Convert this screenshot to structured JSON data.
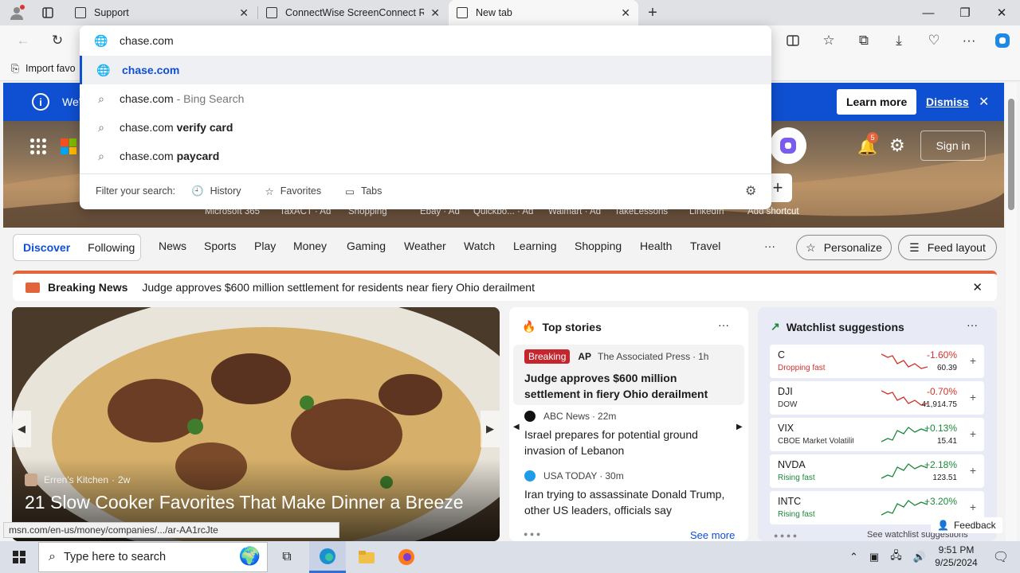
{
  "tabs": [
    {
      "title": "Support"
    },
    {
      "title": "ConnectWise ScreenConnect Re"
    },
    {
      "title": "New tab"
    }
  ],
  "omnibox": {
    "value": "chase.com",
    "suggestions": [
      {
        "text": "chase.com",
        "suffix": ""
      },
      {
        "text": "chase.com",
        "suffix": " - Bing Search"
      },
      {
        "text": "chase.com",
        "bold": " verify card"
      },
      {
        "text": "chase.com",
        "bold": " paycard"
      }
    ],
    "filter_label": "Filter your search:",
    "filters": [
      "History",
      "Favorites",
      "Tabs"
    ]
  },
  "favbar": {
    "import_label": "Import favo"
  },
  "infobar": {
    "text": "We'",
    "learn_more": "Learn more",
    "dismiss": "Dismiss"
  },
  "hero": {
    "sign_in": "Sign in",
    "notif_count": "5",
    "shortcuts": [
      "Microsoft 365",
      "TaxACT · Ad",
      "Shopping",
      "Ebay · Ad",
      "Quickbo... · Ad",
      "Walmart · Ad",
      "TakeLessons",
      "LinkedIn",
      "Add shortcut"
    ]
  },
  "nav": {
    "discover": "Discover",
    "following": "Following",
    "items": [
      "News",
      "Sports",
      "Play",
      "Money",
      "Gaming",
      "Weather",
      "Watch",
      "Learning",
      "Shopping",
      "Health",
      "Travel"
    ],
    "more": "···",
    "personalize": "Personalize",
    "feed_layout": "Feed layout"
  },
  "breaking": {
    "label": "Breaking News",
    "headline": "Judge approves $600 million settlement for residents near fiery Ohio derailment"
  },
  "main_story": {
    "source": "Erren's Kitchen",
    "age": "2w",
    "title": "21 Slow Cooker Favorites That Make Dinner a Breeze"
  },
  "status_url": "msn.com/en-us/money/companies/.../ar-AA1rcJte",
  "top_stories": {
    "title": "Top stories",
    "see_more": "See more",
    "items": [
      {
        "badge": "Breaking",
        "source_logo": "AP",
        "source": "The Associated Press",
        "age": "1h",
        "headline": "Judge approves $600 million settlement in fiery Ohio derailment"
      },
      {
        "source": "ABC News",
        "age": "22m",
        "headline": "Israel prepares for potential ground invasion of Lebanon"
      },
      {
        "source": "USA TODAY",
        "age": "30m",
        "headline": "Iran trying to assassinate Donald Trump, other US leaders, officials say"
      }
    ]
  },
  "watchlist": {
    "title": "Watchlist suggestions",
    "see_more": "See watchlist suggestions",
    "feedback": "Feedback",
    "stocks": [
      {
        "symbol": "C",
        "sub": "Dropping fast",
        "change": "-1.60%",
        "price": "60.39",
        "dir": "down"
      },
      {
        "symbol": "DJI",
        "sub": "DOW",
        "change": "-0.70%",
        "price": "41,914.75",
        "dir": "down"
      },
      {
        "symbol": "VIX",
        "sub": "CBOE Market Volatility Ind...",
        "change": "+0.13%",
        "price": "15.41",
        "dir": "up"
      },
      {
        "symbol": "NVDA",
        "sub": "Rising fast",
        "change": "+2.18%",
        "price": "123.51",
        "dir": "up"
      },
      {
        "symbol": "INTC",
        "sub": "Rising fast",
        "change": "+3.20%",
        "price": "",
        "dir": "up"
      }
    ]
  },
  "taskbar": {
    "search_placeholder": "Type here to search",
    "time": "9:51 PM",
    "date": "9/25/2024"
  },
  "colors": {
    "accent": "#0f4fd1",
    "breaking": "#c4262e",
    "up": "#1a8a3a",
    "down": "#d1342e"
  }
}
